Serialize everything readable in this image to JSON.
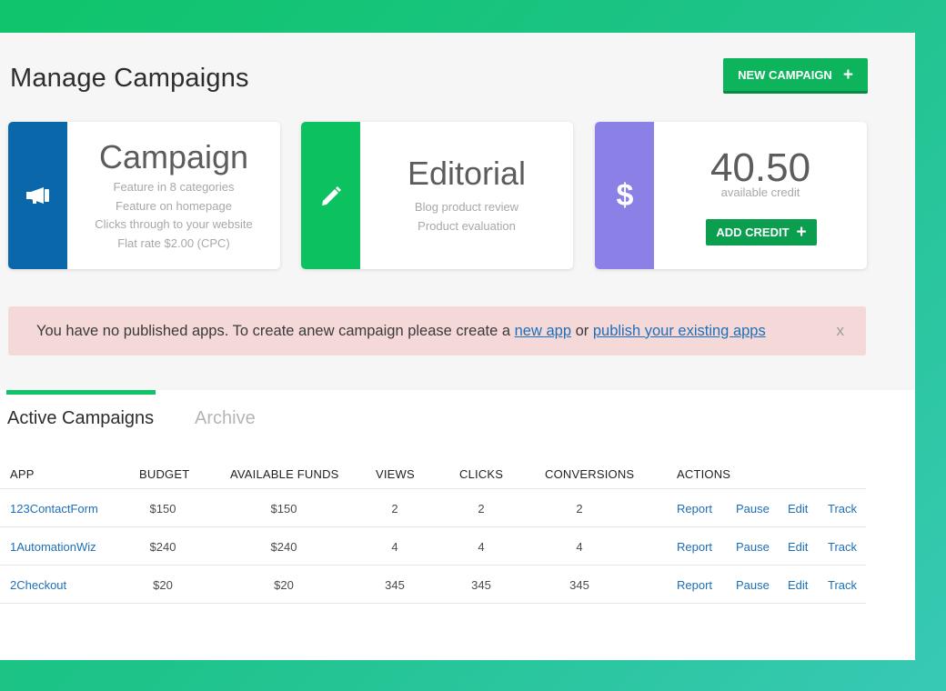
{
  "page": {
    "title": "Manage Campaigns",
    "new_campaign_label": "NEW CAMPAIGN",
    "plus_glyph": "+"
  },
  "cards": {
    "campaign": {
      "icon": "megaphone-icon",
      "title": "Campaign",
      "lines": [
        "Feature in 8 categories",
        "Feature on homepage",
        "Clicks through to your website",
        "Flat rate $2.00 (CPC)"
      ]
    },
    "editorial": {
      "icon": "pencil-icon",
      "title": "Editorial",
      "lines": [
        "Blog product review",
        "Product evaluation"
      ]
    },
    "credit": {
      "icon": "dollar-icon",
      "value": "40.50",
      "label": "available credit",
      "add_label": "ADD CREDIT"
    }
  },
  "alert": {
    "text_before": "You have no published apps. To create anew campaign please create a ",
    "link_new_app": "new app",
    "text_middle": " or ",
    "link_publish": "publish your existing apps",
    "close": "x"
  },
  "tabs": {
    "active": "Active Campaigns",
    "archive": "Archive"
  },
  "table": {
    "headers": {
      "app": "APP",
      "budget": "BUDGET",
      "funds": "AVAILABLE FUNDS",
      "views": "VIEWS",
      "clicks": "CLICKS",
      "conversions": "CONVERSIONS",
      "actions": "ACTIONS"
    },
    "action_labels": {
      "report": "Report",
      "pause": "Pause",
      "edit": "Edit",
      "track": "Track"
    },
    "rows": [
      {
        "app": "123ContactForm",
        "budget": "$150",
        "funds": "$150",
        "views": "2",
        "clicks": "2",
        "conversions": "2"
      },
      {
        "app": "1AutomationWiz",
        "budget": "$240",
        "funds": "$240",
        "views": "4",
        "clicks": "4",
        "conversions": "4"
      },
      {
        "app": "2Checkout",
        "budget": "$20",
        "funds": "$20",
        "views": "345",
        "clicks": "345",
        "conversions": "345"
      }
    ]
  },
  "colors": {
    "accent_green": "#0db45c",
    "campaign_blue": "#0a67a9",
    "editorial_green": "#0cc160",
    "credit_purple": "#8a80e6",
    "alert_bg": "#f5d9d9",
    "link_blue": "#1d6fb8"
  }
}
